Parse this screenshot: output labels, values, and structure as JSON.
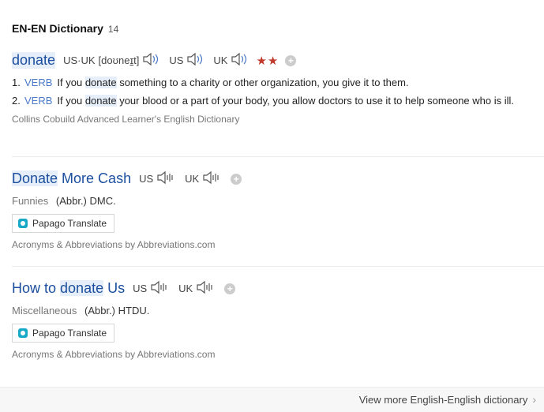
{
  "header": {
    "title": "EN-EN Dictionary",
    "count": "14"
  },
  "entries": [
    {
      "headword": "donate",
      "pron_combined_label": "US·UK",
      "ipa_pre": "[doʊne",
      "ipa_underlined": "ɪ",
      "ipa_post": "t]",
      "us_label": "US",
      "uk_label": "UK",
      "stars": "★★",
      "senses": [
        {
          "num": "1.",
          "pos": "VERB",
          "pre": "If you ",
          "hl": "donate",
          "post": " something to a charity or other organization, you give it to them."
        },
        {
          "num": "2.",
          "pos": "VERB",
          "pre": "If you ",
          "hl": "donate",
          "post": " your blood or a part of your body, you allow doctors to use it to help someone who is ill."
        }
      ],
      "source": "Collins Cobuild Advanced Learner's English Dictionary"
    },
    {
      "headword_hl": "Donate",
      "headword_rest": " More Cash",
      "us_label": "US",
      "uk_label": "UK",
      "category": "Funnies",
      "abbr": "(Abbr.) DMC.",
      "papago_label": "Papago Translate",
      "source": "Acronyms & Abbreviations by Abbreviations.com"
    },
    {
      "headword_pre": "How to ",
      "headword_hl": "donate",
      "headword_post": " Us",
      "us_label": "US",
      "uk_label": "UK",
      "category": "Miscellaneous",
      "abbr": "(Abbr.) HTDU.",
      "papago_label": "Papago Translate",
      "source": "Acronyms & Abbreviations by Abbreviations.com"
    }
  ],
  "footer": {
    "more_label": "View more English-English dictionary"
  },
  "icons": {
    "speaker": "speaker-icon",
    "plus": "plus-icon",
    "papago": "papago-logo-icon",
    "chevron": "chevron-right-icon"
  },
  "colors": {
    "link": "#1b4f9e",
    "highlight_bg": "#e6eef9",
    "pos": "#4a7ac7",
    "stars": "#c0392b"
  }
}
